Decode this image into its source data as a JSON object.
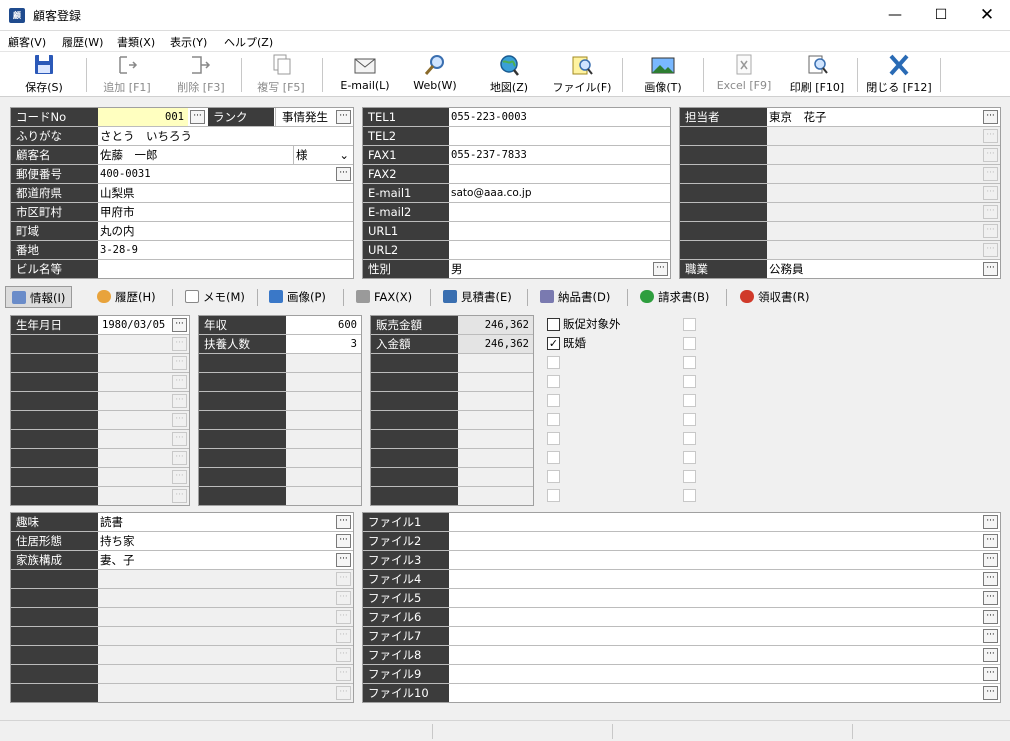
{
  "window": {
    "title": "顧客登録",
    "app_icon_text": "顧"
  },
  "menu": [
    "顧客(V)",
    "履歴(W)",
    "書類(X)",
    "表示(Y)",
    "ヘルプ(Z)"
  ],
  "toolbar": [
    {
      "label": "保存(S)",
      "icon": "save-icon",
      "disabled": false
    },
    {
      "label": "追加 [F1]",
      "icon": "add-icon",
      "disabled": true
    },
    {
      "label": "削除 [F3]",
      "icon": "delete-icon",
      "disabled": true
    },
    {
      "label": "複写 [F5]",
      "icon": "copy-icon",
      "disabled": true
    },
    {
      "label": "E-mail(L)",
      "icon": "mail-icon",
      "disabled": false
    },
    {
      "label": "Web(W)",
      "icon": "web-icon",
      "disabled": false
    },
    {
      "label": "地図(Z)",
      "icon": "map-icon",
      "disabled": false
    },
    {
      "label": "ファイル(F)",
      "icon": "file-icon",
      "disabled": false
    },
    {
      "label": "画像(T)",
      "icon": "image-icon",
      "disabled": false
    },
    {
      "label": "Excel [F9]",
      "icon": "excel-icon",
      "disabled": true
    },
    {
      "label": "印刷 [F10]",
      "icon": "print-icon",
      "disabled": false
    },
    {
      "label": "閉じる [F12]",
      "icon": "close-icon",
      "disabled": false
    }
  ],
  "customer": {
    "code_label": "コードNo",
    "code": "001",
    "rank_label": "ランク",
    "rank": "事情発生",
    "kana_label": "ふりがな",
    "kana": "さとう　いちろう",
    "name_label": "顧客名",
    "name": "佐藤　一郎",
    "honorific": "様",
    "zip_label": "郵便番号",
    "zip": "400-0031",
    "pref_label": "都道府県",
    "pref": "山梨県",
    "city_label": "市区町村",
    "city": "甲府市",
    "town_label": "町域",
    "town": "丸の内",
    "addr_label": "番地",
    "addr": "3-28-9",
    "bldg_label": "ビル名等",
    "bldg": ""
  },
  "contact": {
    "tel1_label": "TEL1",
    "tel1": "055-223-0003",
    "tel2_label": "TEL2",
    "tel2": "",
    "fax1_label": "FAX1",
    "fax1": "055-237-7833",
    "fax2_label": "FAX2",
    "fax2": "",
    "mail1_label": "E-mail1",
    "mail1": "sato@aaa.co.jp",
    "mail2_label": "E-mail2",
    "mail2": "",
    "url1_label": "URL1",
    "url1": "",
    "url2_label": "URL2",
    "url2": "",
    "sex_label": "性別",
    "sex": "男"
  },
  "staff": {
    "person_label": "担当者",
    "person": "東京　花子",
    "job_label": "職業",
    "job": "公務員"
  },
  "tabs": [
    "情報(I)",
    "履歴(H)",
    "メモ(M)",
    "画像(P)",
    "FAX(X)",
    "見積書(E)",
    "納品書(D)",
    "請求書(B)",
    "領収書(R)"
  ],
  "info": {
    "birth_label": "生年月日",
    "birth": "1980/03/05",
    "income_label": "年収",
    "income": "600",
    "dependents_label": "扶養人数",
    "dependents": "3",
    "sales_label": "販売金額",
    "sales": "246,362",
    "paid_label": "入金額",
    "paid": "246,362",
    "check1_label": "販促対象外",
    "check1": false,
    "check2_label": "既婚",
    "check2": true
  },
  "profile": {
    "hobby_label": "趣味",
    "hobby": "読書",
    "house_label": "住居形態",
    "house": "持ち家",
    "family_label": "家族構成",
    "family": "妻、子"
  },
  "files": [
    "ファイル1",
    "ファイル2",
    "ファイル3",
    "ファイル4",
    "ファイル5",
    "ファイル6",
    "ファイル7",
    "ファイル8",
    "ファイル9",
    "ファイル10"
  ]
}
